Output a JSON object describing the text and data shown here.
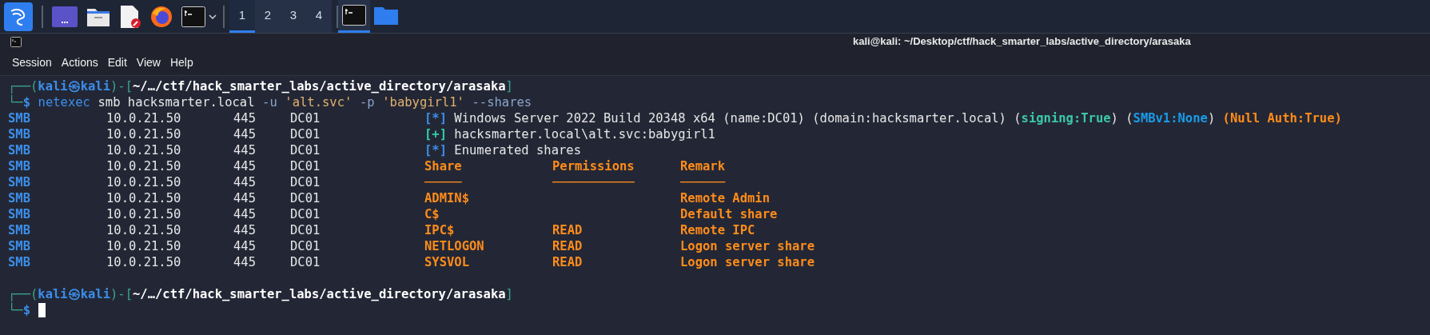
{
  "taskbar": {
    "launchers": [
      {
        "kind": "kali-menu"
      },
      {
        "kind": "desktop"
      },
      {
        "kind": "files"
      },
      {
        "kind": "editor"
      },
      {
        "kind": "browser"
      },
      {
        "kind": "terminal-dropdown"
      }
    ],
    "workspaces": [
      {
        "label": "1",
        "selected": true
      },
      {
        "label": "2",
        "selected": false
      },
      {
        "label": "3",
        "selected": false
      },
      {
        "label": "4",
        "selected": false
      }
    ],
    "tasks": [
      {
        "kind": "terminal",
        "selected": true
      },
      {
        "kind": "folder",
        "selected": false
      }
    ]
  },
  "window": {
    "title": "kali@kali: ~/Desktop/ctf/hack_smarter_labs/active_directory/arasaka",
    "menu": [
      "Session",
      "Actions",
      "Edit",
      "View",
      "Help"
    ]
  },
  "terminal": {
    "lines": [
      {
        "kind": "prompt",
        "segments": [
          {
            "text": "┌──(",
            "kind": "frame"
          },
          {
            "text": "kali㉿kali",
            "kind": "user"
          },
          {
            "text": ")-[",
            "kind": "frame"
          },
          {
            "text": "~/…/ctf/hack_smarter_labs/active_directory/arasaka",
            "kind": "path"
          },
          {
            "text": "]",
            "kind": "frame"
          }
        ]
      },
      {
        "kind": "command",
        "segments": [
          {
            "text": "└─",
            "kind": "frame"
          },
          {
            "text": "$",
            "kind": "user"
          },
          {
            "text": "netexec",
            "kind": "program"
          },
          {
            "text": "smb hacksmarter.local",
            "kind": "plain"
          },
          {
            "text": "-u",
            "kind": "flag"
          },
          {
            "text": "'alt.svc'",
            "kind": "string"
          },
          {
            "text": "-p",
            "kind": "flag"
          },
          {
            "text": "'babygirl1'",
            "kind": "string"
          },
          {
            "text": "--shares",
            "kind": "flag"
          }
        ]
      },
      {
        "kind": "output",
        "protocol": "SMB",
        "host": "10.0.21.50",
        "port": "445",
        "name": "DC01",
        "segments": [
          {
            "text": "[*]",
            "kind": "info"
          },
          {
            "text": " Windows Server 2022 Build 20348 x64 (name:DC01) (domain:hacksmarter.local) (",
            "kind": "plain"
          },
          {
            "text": "signing:True",
            "kind": "teal"
          },
          {
            "text": ") (",
            "kind": "plain"
          },
          {
            "text": "SMBv1:None",
            "kind": "blue"
          },
          {
            "text": ") ",
            "kind": "plain"
          },
          {
            "text": "(Null Auth:True)",
            "kind": "orange"
          }
        ]
      },
      {
        "kind": "output",
        "protocol": "SMB",
        "host": "10.0.21.50",
        "port": "445",
        "name": "DC01",
        "segments": [
          {
            "text": "[+]",
            "kind": "ok"
          },
          {
            "text": " hacksmarter.local\\alt.svc:babygirl1",
            "kind": "plain"
          }
        ]
      },
      {
        "kind": "output",
        "protocol": "SMB",
        "host": "10.0.21.50",
        "port": "445",
        "name": "DC01",
        "segments": [
          {
            "text": "[*]",
            "kind": "info"
          },
          {
            "text": " Enumerated shares",
            "kind": "plain"
          }
        ]
      },
      {
        "kind": "output",
        "protocol": "SMB",
        "host": "10.0.21.50",
        "port": "445",
        "name": "DC01",
        "cells": [
          "Share",
          "Permissions",
          "Remark"
        ]
      },
      {
        "kind": "output",
        "protocol": "SMB",
        "host": "10.0.21.50",
        "port": "445",
        "name": "DC01",
        "cells": [
          "─────",
          "───────────",
          "──────"
        ]
      },
      {
        "kind": "output",
        "protocol": "SMB",
        "host": "10.0.21.50",
        "port": "445",
        "name": "DC01",
        "cells": [
          "ADMIN$",
          "",
          "Remote Admin"
        ]
      },
      {
        "kind": "output",
        "protocol": "SMB",
        "host": "10.0.21.50",
        "port": "445",
        "name": "DC01",
        "cells": [
          "C$",
          "",
          "Default share"
        ]
      },
      {
        "kind": "output",
        "protocol": "SMB",
        "host": "10.0.21.50",
        "port": "445",
        "name": "DC01",
        "cells": [
          "IPC$",
          "READ",
          "Remote IPC"
        ]
      },
      {
        "kind": "output",
        "protocol": "SMB",
        "host": "10.0.21.50",
        "port": "445",
        "name": "DC01",
        "cells": [
          "NETLOGON",
          "READ",
          "Logon server share"
        ]
      },
      {
        "kind": "output",
        "protocol": "SMB",
        "host": "10.0.21.50",
        "port": "445",
        "name": "DC01",
        "cells": [
          "SYSVOL",
          "READ",
          "Logon server share"
        ]
      },
      {
        "kind": "blank"
      },
      {
        "kind": "prompt",
        "segments": [
          {
            "text": "┌──(",
            "kind": "frame"
          },
          {
            "text": "kali㉿kali",
            "kind": "user"
          },
          {
            "text": ")-[",
            "kind": "frame"
          },
          {
            "text": "~/…/ctf/hack_smarter_labs/active_directory/arasaka",
            "kind": "path"
          },
          {
            "text": "]",
            "kind": "frame"
          }
        ]
      },
      {
        "kind": "input",
        "segments": [
          {
            "text": "└─",
            "kind": "frame"
          },
          {
            "text": "$",
            "kind": "user"
          }
        ],
        "cursor": true
      }
    ]
  }
}
